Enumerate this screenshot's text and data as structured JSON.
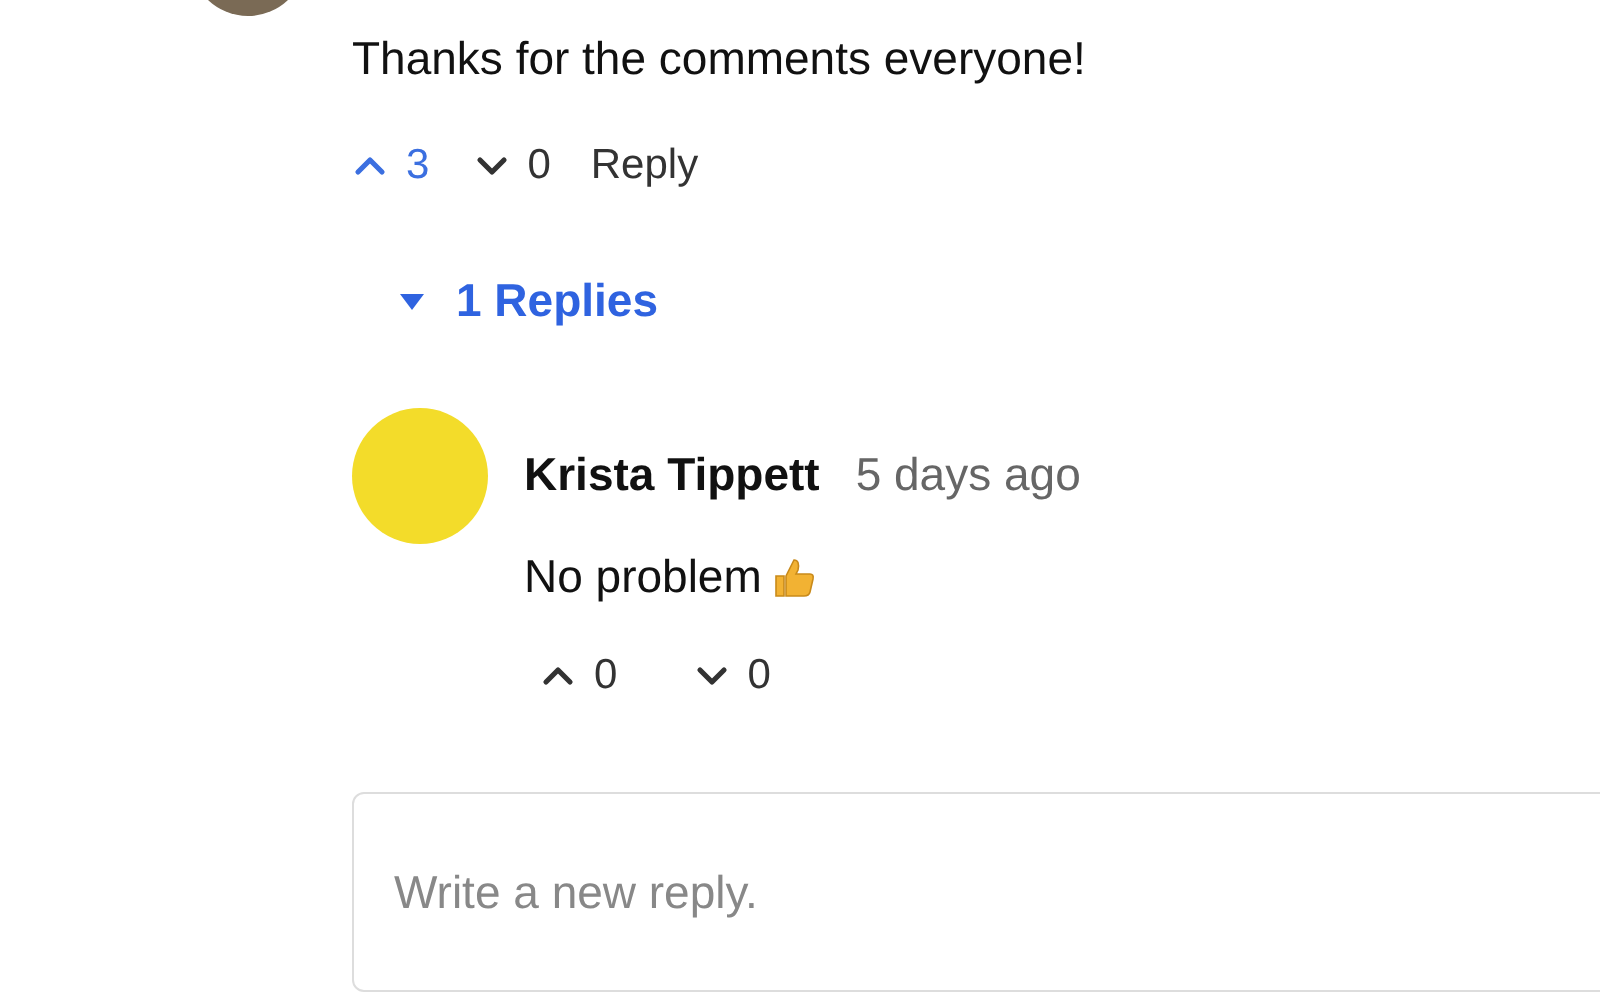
{
  "comment": {
    "text": "Thanks for the comments everyone!",
    "votes": {
      "up": "3",
      "up_selected": true,
      "down": "0",
      "down_selected": false
    },
    "reply_button": "Reply",
    "replies_toggle": {
      "label": "1 Replies",
      "expanded": true
    }
  },
  "replies": [
    {
      "author": "Krista Tippett",
      "time": "5 days ago",
      "text": "No problem",
      "votes": {
        "up": "0",
        "up_selected": false,
        "down": "0",
        "down_selected": false
      }
    }
  ],
  "reply_field": {
    "placeholder": "Write a new reply."
  }
}
